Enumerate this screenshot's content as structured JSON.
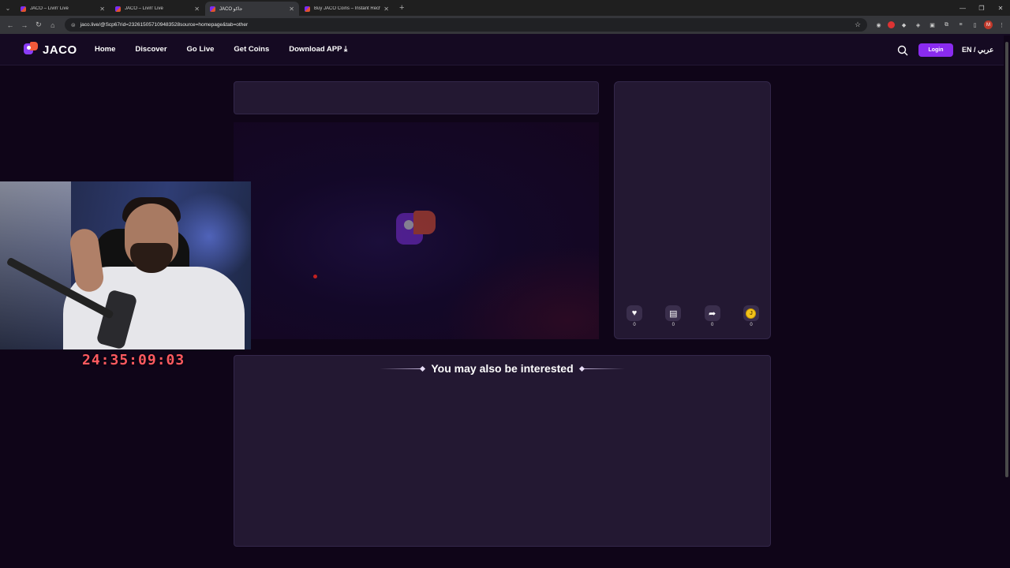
{
  "browser": {
    "tabs": [
      {
        "title": "JACO – Livin' Live",
        "active": false
      },
      {
        "title": "JACO – Livin' Live",
        "active": false
      },
      {
        "title": "JACO جاكو",
        "active": true
      },
      {
        "title": "Buy JACO Coins – Instant Rech",
        "active": false
      }
    ],
    "url": "jaco.live/@Scp67rid=232615057109483528source=homepage&tab=other",
    "profile_initial": "M"
  },
  "header": {
    "logo_text": "JACO",
    "nav": [
      "Home",
      "Discover",
      "Go Live",
      "Get Coins",
      "Download APP"
    ],
    "login_label": "Login",
    "lang_label": "EN / عربي"
  },
  "actions": {
    "like_count": "0",
    "comment_count": "0",
    "share_count": "0",
    "gift_count": "0",
    "coin_glyph": "J"
  },
  "interest": {
    "title": "You may also be interested"
  },
  "overlay": {
    "timer": "24:35:09:03"
  },
  "colors": {
    "accent": "#8a2bf0",
    "logo_orange": "#f25a3a",
    "timer": "#ff5a60",
    "background": "#0f0518"
  }
}
